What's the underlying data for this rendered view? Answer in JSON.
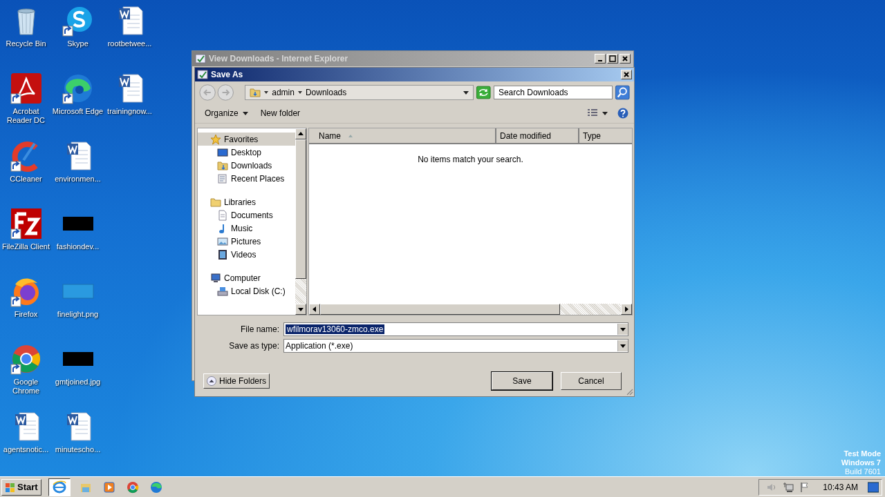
{
  "desktop": {
    "columns": [
      [
        {
          "label": "Recycle Bin",
          "kind": "recycle",
          "shortcut": false
        },
        {
          "label": "Acrobat Reader DC",
          "kind": "acrobat",
          "shortcut": true
        },
        {
          "label": "CCleaner",
          "kind": "ccleaner",
          "shortcut": true
        },
        {
          "label": "FileZilla Client",
          "kind": "filezilla",
          "shortcut": true
        },
        {
          "label": "Firefox",
          "kind": "firefox",
          "shortcut": true
        },
        {
          "label": "Google Chrome",
          "kind": "chrome",
          "shortcut": true
        },
        {
          "label": "agentsnotic...",
          "kind": "word",
          "shortcut": false
        }
      ],
      [
        {
          "label": "Skype",
          "kind": "skype",
          "shortcut": true
        },
        {
          "label": "Microsoft Edge",
          "kind": "edge",
          "shortcut": true
        },
        {
          "label": "environmen...",
          "kind": "word",
          "shortcut": false
        },
        {
          "label": "fashiondev...",
          "kind": "dark-thumb",
          "shortcut": false
        },
        {
          "label": "finelight.png",
          "kind": "light-thumb",
          "shortcut": false
        },
        {
          "label": "gmtjoined.jpg",
          "kind": "dark-thumb",
          "shortcut": false
        },
        {
          "label": "minutescho...",
          "kind": "word",
          "shortcut": false
        }
      ],
      [
        {
          "label": "rootbetwee...",
          "kind": "word",
          "shortcut": false
        },
        {
          "label": "trainingnow...",
          "kind": "word",
          "shortcut": false
        }
      ]
    ],
    "os_notice": [
      "Test Mode",
      "Windows 7",
      "Build 7601"
    ]
  },
  "background_window": {
    "title": "View Downloads - Internet Explorer"
  },
  "dialog": {
    "title": "Save As",
    "breadcrumbs": [
      "admin",
      "Downloads"
    ],
    "search": {
      "placeholder": "Search Downloads"
    },
    "toolbar": {
      "organize": "Organize",
      "new_folder": "New folder"
    },
    "tree": [
      {
        "label": "Favorites",
        "kind": "star",
        "selected": true,
        "children": [
          {
            "label": "Desktop",
            "kind": "desktop",
            "selected": false
          },
          {
            "label": "Downloads",
            "kind": "downloads",
            "selected": false
          },
          {
            "label": "Recent Places",
            "kind": "recent",
            "selected": false
          }
        ]
      },
      {
        "label": "Libraries",
        "kind": "libraries",
        "selected": false,
        "children": [
          {
            "label": "Documents",
            "kind": "documents",
            "selected": false
          },
          {
            "label": "Music",
            "kind": "music",
            "selected": false
          },
          {
            "label": "Pictures",
            "kind": "pictures",
            "selected": false
          },
          {
            "label": "Videos",
            "kind": "videos",
            "selected": false
          }
        ]
      },
      {
        "label": "Computer",
        "kind": "computer",
        "selected": false,
        "children": [
          {
            "label": "Local Disk (C:)",
            "kind": "disk",
            "selected": false
          }
        ]
      }
    ],
    "columns": [
      {
        "label": "Name",
        "sorted": true
      },
      {
        "label": "Date modified",
        "sorted": false
      },
      {
        "label": "Type",
        "sorted": false
      }
    ],
    "empty_message": "No items match your search.",
    "file_name": {
      "label": "File name:",
      "value": "wfilmorav13060-zmco.exe"
    },
    "save_as_type": {
      "label": "Save as type:",
      "value": "Application (*.exe)"
    },
    "hide_folders": "Hide Folders",
    "buttons": [
      {
        "label": "Save",
        "default": true
      },
      {
        "label": "Cancel",
        "default": false
      }
    ]
  },
  "taskbar": {
    "start": "Start",
    "apps": [
      {
        "kind": "ie",
        "selected": true
      },
      {
        "kind": "explorer",
        "selected": false
      },
      {
        "kind": "player",
        "selected": false
      },
      {
        "kind": "chrome",
        "selected": false
      },
      {
        "kind": "edge",
        "selected": false
      }
    ],
    "clock": "10:43 AM"
  }
}
